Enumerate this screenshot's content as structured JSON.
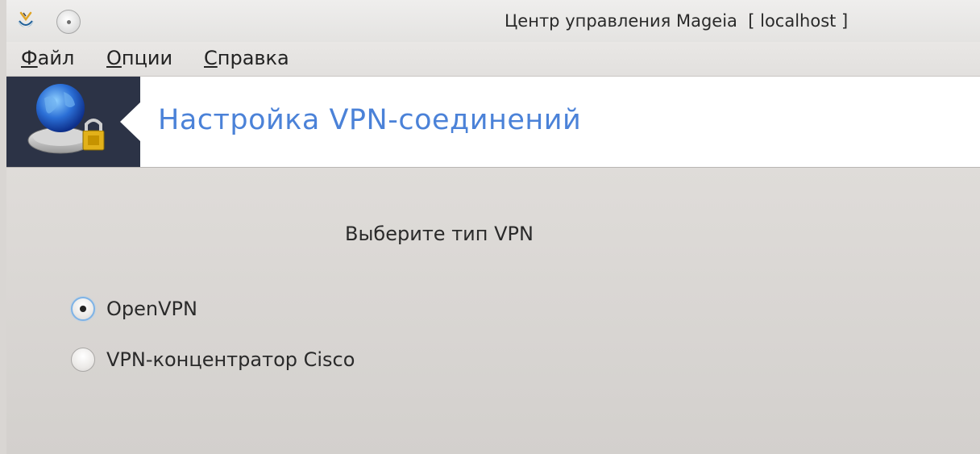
{
  "window": {
    "title": "Центр управления Mageia  [ localhost ]",
    "app_icon": "mageia-cauldron-icon",
    "control_icon": "window-menu-circle-icon"
  },
  "menubar": {
    "items": [
      {
        "mnemonic": "Ф",
        "rest": "айл"
      },
      {
        "mnemonic": "О",
        "rest": "пции"
      },
      {
        "mnemonic": "С",
        "rest": "правка"
      }
    ]
  },
  "banner": {
    "title": "Настройка VPN-соединений",
    "icon": "vpn-globe-lock-icon",
    "title_color": "#4b82d8",
    "icon_bg_color": "#2c3346"
  },
  "content": {
    "prompt": "Выберите тип VPN",
    "options": [
      {
        "label": "OpenVPN",
        "selected": true
      },
      {
        "label": "VPN-концентратор Cisco",
        "selected": false
      }
    ],
    "focus_color": "#7fb3e6"
  }
}
